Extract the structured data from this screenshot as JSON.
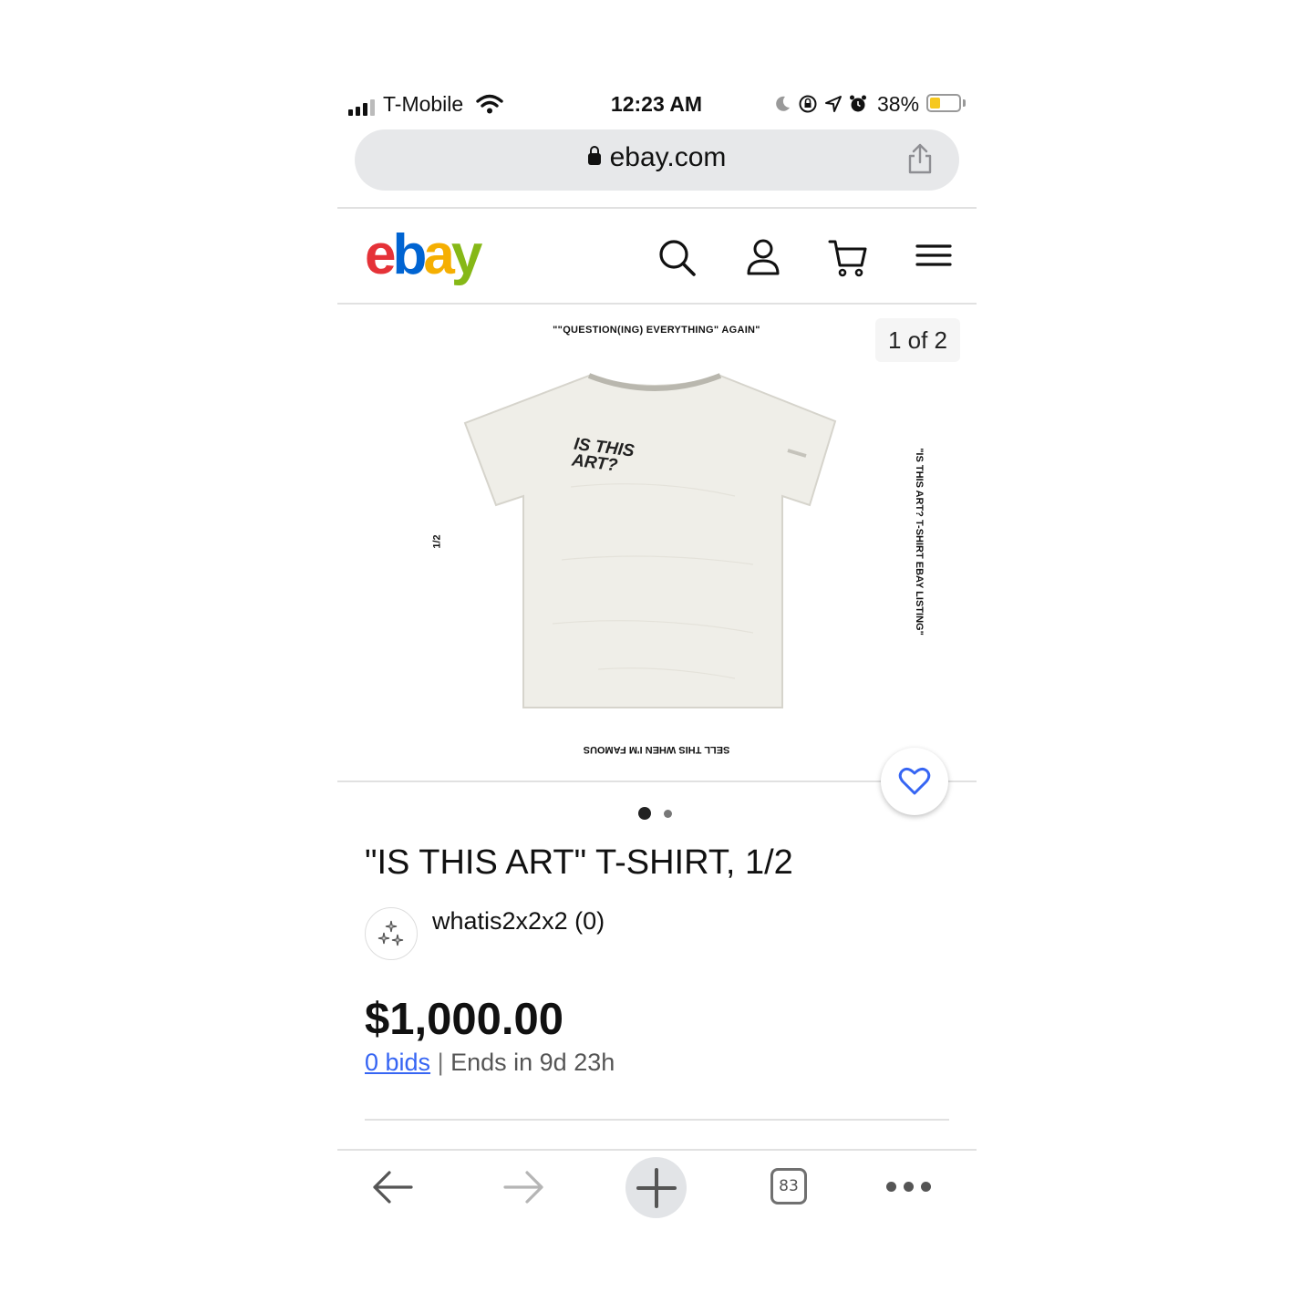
{
  "status_bar": {
    "carrier": "T-Mobile",
    "time": "12:23 AM",
    "battery_percent": "38%",
    "battery_level": 0.38,
    "battery_color": "#f6c81e",
    "icons": [
      "signal-icon",
      "wifi-icon",
      "moon-icon",
      "rotation-lock-icon",
      "location-arrow-icon",
      "alarm-icon",
      "battery-icon"
    ]
  },
  "browser": {
    "url": "ebay.com",
    "lock_icon": "lock-icon",
    "share_icon": "share-icon"
  },
  "header": {
    "logo_letters": [
      "e",
      "b",
      "a",
      "y"
    ],
    "logo_colors": [
      "#e53238",
      "#0064d2",
      "#f5af02",
      "#86b817"
    ],
    "icons": [
      "search-icon",
      "account-icon",
      "cart-icon",
      "menu-icon"
    ]
  },
  "gallery": {
    "image_top_text": "\"\"QUESTION(ING) EVERYTHING\" AGAIN\"",
    "image_bottom_text": "SELL THIS WHEN I'M FAMOUS",
    "image_left_text": "1/2",
    "image_right_text": "\"IS THIS ART? T-SHIRT EBAY LISTING\"",
    "shirt_print": "IS THIS ART?",
    "counter": "1 of 2",
    "current_index": 1,
    "total": 2
  },
  "listing": {
    "title": "\"IS THIS ART\" T-SHIRT, 1/2",
    "seller": "whatis2x2x2 (0)",
    "price": "$1,000.00",
    "bids": "0 bids",
    "separator": "|",
    "ends": "Ends in 9d 23h",
    "link_color": "#3665f3"
  },
  "toolbar": {
    "tab_count": "83",
    "icons": [
      "back-arrow-icon",
      "forward-arrow-icon",
      "new-tab-plus-icon",
      "tabs-icon",
      "more-icon"
    ]
  }
}
